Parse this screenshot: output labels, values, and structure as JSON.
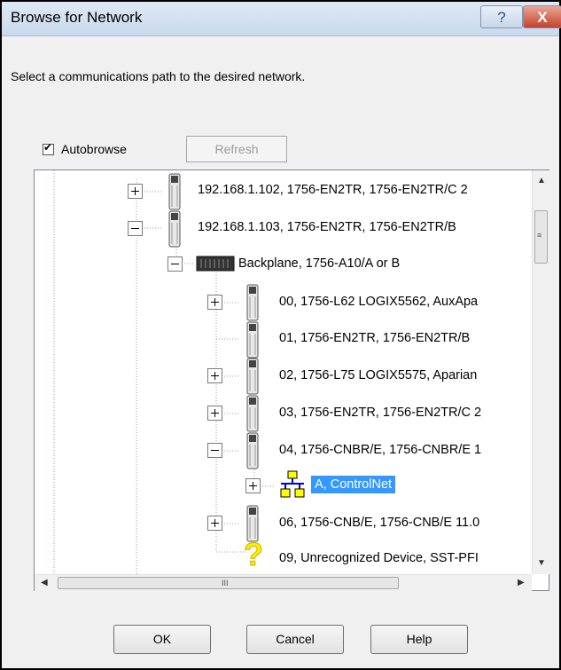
{
  "window": {
    "title": "Browse for Network",
    "help_label": "?",
    "close_label": "X"
  },
  "instruction": "Select a communications path to the desired network.",
  "autobrowse": {
    "label": "Autobrowse",
    "checked": true
  },
  "refresh_label": "Refresh",
  "tree": {
    "nodes": [
      {
        "label": "192.168.1.102, 1756-EN2TR, 1756-EN2TR/C 2",
        "icon": "module-icon",
        "expander": "plus"
      },
      {
        "label": "192.168.1.103, 1756-EN2TR, 1756-EN2TR/B",
        "icon": "module-icon",
        "expander": "minus"
      },
      {
        "label": "Backplane, 1756-A10/A or B",
        "icon": "backplane-icon",
        "expander": "minus"
      },
      {
        "label": "00, 1756-L62 LOGIX5562, AuxApa",
        "icon": "module-icon",
        "expander": "plus"
      },
      {
        "label": "01, 1756-EN2TR, 1756-EN2TR/B",
        "icon": "module-icon",
        "expander": "none"
      },
      {
        "label": "02, 1756-L75 LOGIX5575, Aparian",
        "icon": "module-icon",
        "expander": "plus"
      },
      {
        "label": "03, 1756-EN2TR, 1756-EN2TR/C 2",
        "icon": "module-icon",
        "expander": "plus"
      },
      {
        "label": "04, 1756-CNBR/E, 1756-CNBR/E 1",
        "icon": "module-icon",
        "expander": "minus"
      },
      {
        "label": "A, ControlNet",
        "icon": "network-icon",
        "expander": "plus",
        "selected": true
      },
      {
        "label": "06, 1756-CNB/E, 1756-CNB/E 11.0",
        "icon": "module-icon",
        "expander": "plus"
      },
      {
        "label": "09, Unrecognized Device, SST-PFI",
        "icon": "question-icon",
        "expander": "none"
      }
    ]
  },
  "scroll": {
    "h_grip": "III"
  },
  "buttons": {
    "ok": "OK",
    "cancel": "Cancel",
    "help": "Help"
  },
  "colors": {
    "selection": "#3399ff",
    "title_bg": "#c9d9ee",
    "close_bg": "#c4412a"
  }
}
